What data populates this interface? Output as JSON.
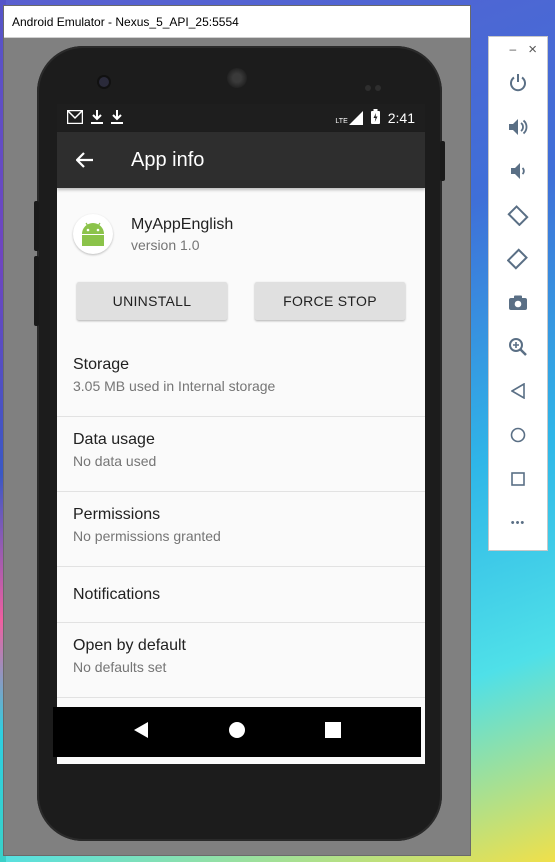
{
  "window": {
    "title": "Android Emulator - Nexus_5_API_25:5554"
  },
  "statusbar": {
    "time": "2:41",
    "network": "LTE"
  },
  "appbar": {
    "title": "App info"
  },
  "app": {
    "name": "MyAppEnglish",
    "version": "version 1.0"
  },
  "buttons": {
    "uninstall": "UNINSTALL",
    "force_stop": "FORCE STOP"
  },
  "items": [
    {
      "title": "Storage",
      "subtitle": "3.05 MB used in Internal storage"
    },
    {
      "title": "Data usage",
      "subtitle": "No data used"
    },
    {
      "title": "Permissions",
      "subtitle": "No permissions granted"
    },
    {
      "title": "Notifications"
    },
    {
      "title": "Open by default",
      "subtitle": "No defaults set"
    }
  ],
  "panel": {
    "minimize": "–",
    "close": "×",
    "icons": [
      "power-icon",
      "volume-up-icon",
      "volume-down-icon",
      "rotate-left-icon",
      "rotate-right-icon",
      "camera-icon",
      "zoom-icon",
      "back-icon",
      "home-icon",
      "overview-icon",
      "more-icon"
    ],
    "more": "•••"
  },
  "colors": {
    "appbar": "#2e2e2e",
    "statusbar": "#1e1e1e",
    "button": "#e0e0e0",
    "panel_icon": "#5a6f85",
    "android_green": "#8bc34a"
  }
}
